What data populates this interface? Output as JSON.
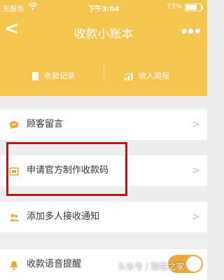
{
  "status_bar": {
    "carrier": "无服务",
    "time": "下午3:04",
    "battery_pct": "73%",
    "battery_level": 0.73
  },
  "nav": {
    "back": "<",
    "title": "收款小账本",
    "more": "•••"
  },
  "segments": {
    "records": "收款记录",
    "brief": "收入简报"
  },
  "rows": [
    {
      "label": "顾客留言"
    },
    {
      "label": "申请官方制作收款码"
    },
    {
      "label": "添加多人接收通知"
    },
    {
      "label": "收款语音提醒"
    }
  ],
  "voice_toggle_on": true,
  "watermark": "头条号 / 聊惠之家",
  "colors": {
    "accent": "#f4c54f",
    "icon": "#e8a935",
    "highlight": "#b21a1a",
    "background": "#eeeeee"
  }
}
